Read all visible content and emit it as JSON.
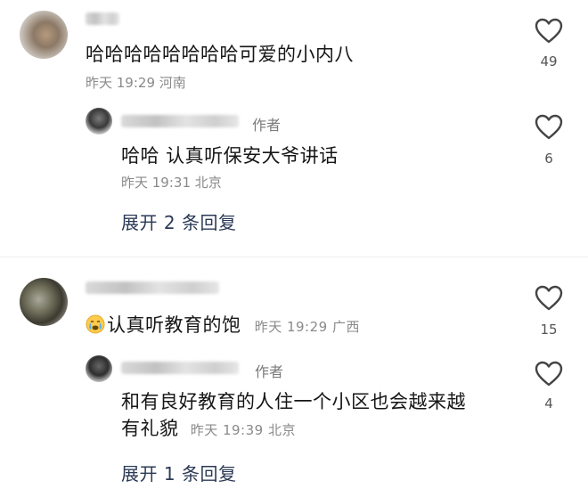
{
  "comments": [
    {
      "text": "哈哈哈哈哈哈哈哈可爱的小内八",
      "time": "昨天 19:29",
      "location": "河南",
      "likes": "49",
      "replies": [
        {
          "author_tag": "作者",
          "text": "哈哈 认真听保安大爷讲话",
          "time": "昨天 19:31",
          "location": "北京",
          "likes": "6"
        }
      ],
      "expand_label": "展开 2 条回复"
    },
    {
      "text": "认真听教育的饱",
      "time": "昨天 19:29",
      "location": "广西",
      "likes": "15",
      "emoji_icon": "crying-face-icon",
      "replies": [
        {
          "author_tag": "作者",
          "text_line1": "和有良好教育的人住一个小区也会越来越",
          "text_line2": "有礼貌",
          "time": "昨天 19:39",
          "location": "北京",
          "likes": "4"
        }
      ],
      "expand_label": "展开 1 条回复"
    }
  ],
  "icons": {
    "like": "heart-outline-icon"
  },
  "colors": {
    "meta": "#8a8a8a",
    "expand_link": "#2b3a55",
    "text": "#161616"
  }
}
